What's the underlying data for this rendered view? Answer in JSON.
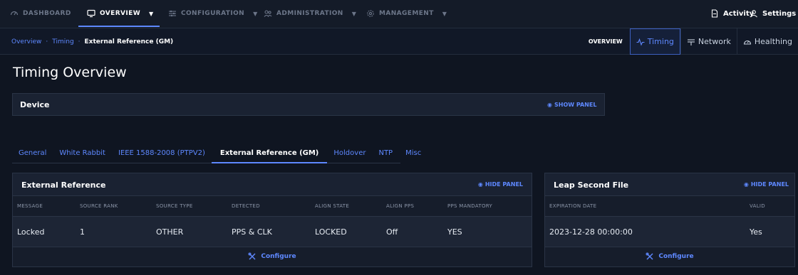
{
  "topnav": {
    "items": [
      {
        "label": "DASHBOARD",
        "icon": "dashboard-icon"
      },
      {
        "label": "OVERVIEW",
        "icon": "monitor-icon"
      },
      {
        "label": "CONFIGURATION",
        "icon": "sliders-icon"
      },
      {
        "label": "ADMINISTRATION",
        "icon": "users-icon"
      },
      {
        "label": "MANAGEMENT",
        "icon": "gear-icon"
      }
    ],
    "activity_label": "Activity",
    "settings_label": "Settings"
  },
  "breadcrumb": {
    "items": [
      "Overview",
      "Timing"
    ],
    "separator": "·",
    "current": "External Reference (GM)"
  },
  "view_tabs": {
    "overview_label": "OVERVIEW",
    "tabs": [
      {
        "label": "Timing",
        "icon": "pulse-icon",
        "active": true
      },
      {
        "label": "Network",
        "icon": "network-icon",
        "active": false
      },
      {
        "label": "Healthing",
        "icon": "gauge-icon",
        "active": false
      }
    ]
  },
  "page_title": "Timing Overview",
  "device_panel": {
    "title": "Device",
    "action": "SHOW PANEL"
  },
  "subtabs": [
    {
      "label": "General",
      "active": false
    },
    {
      "label": "White Rabbit",
      "active": false
    },
    {
      "label": "IEEE 1588-2008 (PTPV2)",
      "active": false
    },
    {
      "label": "External Reference (GM)",
      "active": true
    },
    {
      "label": "Holdover",
      "active": false
    },
    {
      "label": "NTP",
      "active": false
    },
    {
      "label": "Misc",
      "active": false
    }
  ],
  "external_reference": {
    "title": "External Reference",
    "action": "HIDE PANEL",
    "columns": [
      "MESSAGE",
      "SOURCE RANK",
      "SOURCE TYPE",
      "DETECTED",
      "ALIGN STATE",
      "ALIGN PPS",
      "PPS MANDATORY"
    ],
    "row": [
      "Locked",
      "1",
      "OTHER",
      "PPS & CLK",
      "LOCKED",
      "Off",
      "YES"
    ],
    "configure_label": "Configure"
  },
  "leap_second": {
    "title": "Leap Second File",
    "action": "HIDE PANEL",
    "columns": [
      "EXPIRATION DATE",
      "VALID"
    ],
    "row": [
      "2023-12-28 00:00:00",
      "Yes"
    ],
    "configure_label": "Configure"
  },
  "colors": {
    "background": "#0f1521",
    "accent": "#5e88ff",
    "panel": "#1a2232"
  }
}
